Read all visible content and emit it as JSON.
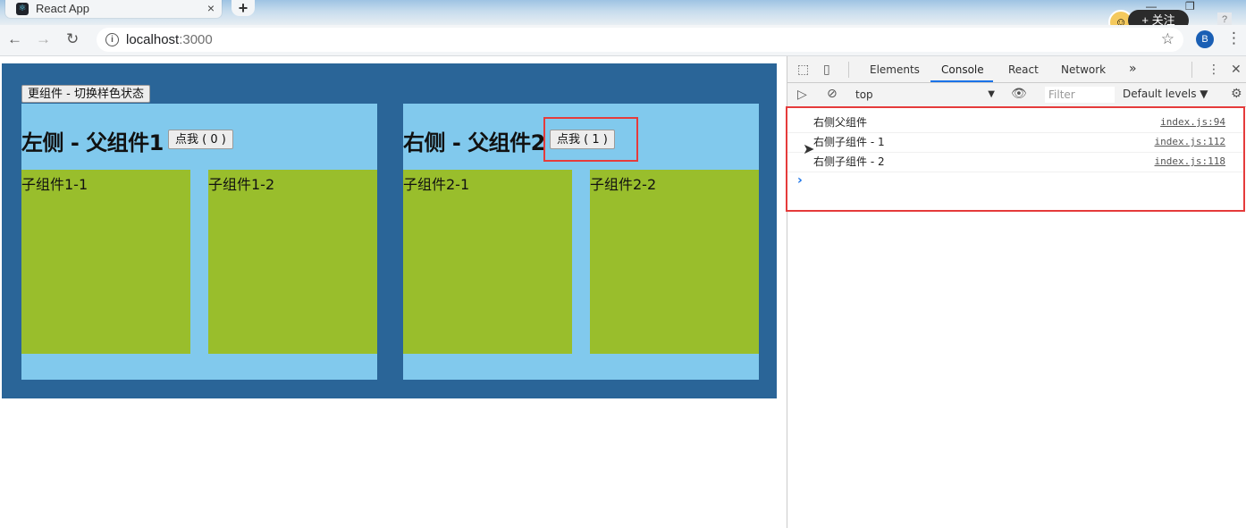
{
  "browser": {
    "tab_title": "React App",
    "tab_close": "×",
    "new_tab": "+",
    "url_host": "localhost",
    "url_port": ":3000",
    "follow_label": "+ 关注",
    "help": "?",
    "icons": {
      "back": "back-arrow-icon",
      "forward": "forward-arrow-icon",
      "reload": "reload-icon",
      "info": "info-icon",
      "star": "star-icon",
      "menu": "menu-icon"
    }
  },
  "app": {
    "switch_button": "更组件 - 切换样色状态",
    "left_parent": {
      "title": "左侧 - 父组件1",
      "button": "点我 ( 0 )",
      "children": [
        "子组件1-1",
        "子组件1-2"
      ]
    },
    "right_parent": {
      "title": "右侧 - 父组件2",
      "button": "点我 ( 1 )",
      "children": [
        "子组件2-1",
        "子组件2-2"
      ]
    },
    "colors": {
      "app_bg": "#2a6598",
      "parent_bg": "#81c9ed",
      "child_bg": "#99be2c",
      "highlight": "#e53b3b"
    }
  },
  "devtools": {
    "tabs": [
      "Elements",
      "Console",
      "React",
      "Network"
    ],
    "active_tab": "Console",
    "more": "»",
    "context": "top",
    "filter_placeholder": "Filter",
    "levels": "Default levels ▼",
    "logs": [
      {
        "message": "右侧父组件",
        "source": "index.js:94"
      },
      {
        "message": "右侧子组件 - 1",
        "source": "index.js:112"
      },
      {
        "message": "右侧子组件 - 2",
        "source": "index.js:118"
      }
    ],
    "prompt": "›"
  }
}
